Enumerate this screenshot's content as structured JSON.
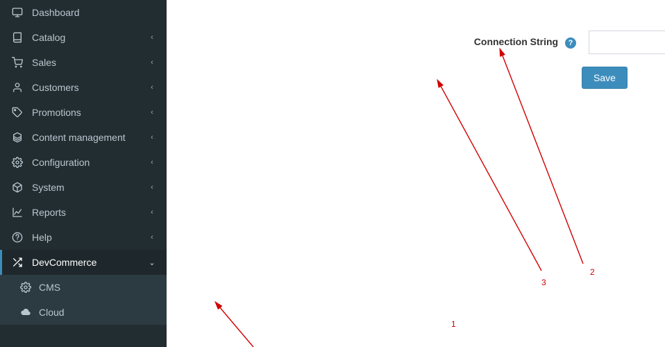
{
  "sidebar": {
    "items": [
      {
        "label": "Dashboard",
        "icon": "monitor",
        "expandable": false,
        "active": false
      },
      {
        "label": "Catalog",
        "icon": "book",
        "expandable": true,
        "active": false
      },
      {
        "label": "Sales",
        "icon": "cart",
        "expandable": true,
        "active": false
      },
      {
        "label": "Customers",
        "icon": "user",
        "expandable": true,
        "active": false
      },
      {
        "label": "Promotions",
        "icon": "tags",
        "expandable": true,
        "active": false
      },
      {
        "label": "Content management",
        "icon": "cubes",
        "expandable": true,
        "active": false
      },
      {
        "label": "Configuration",
        "icon": "gear",
        "expandable": true,
        "active": false
      },
      {
        "label": "System",
        "icon": "box",
        "expandable": true,
        "active": false
      },
      {
        "label": "Reports",
        "icon": "chart",
        "expandable": true,
        "active": false
      },
      {
        "label": "Help",
        "icon": "help",
        "expandable": true,
        "active": false
      },
      {
        "label": "DevCommerce",
        "icon": "shuffle",
        "expandable": true,
        "active": true,
        "children": [
          {
            "label": "CMS",
            "icon": "gear"
          },
          {
            "label": "Cloud",
            "icon": "cloud"
          }
        ]
      }
    ]
  },
  "form": {
    "connection_string_label": "Connection String",
    "connection_string_value": "",
    "save_label": "Save"
  },
  "annotations": {
    "n1": "1",
    "n2": "2",
    "n3": "3"
  },
  "icon_glyphs": {
    "monitor": "svg:monitor",
    "book": "svg:book",
    "cart": "svg:cart",
    "user": "svg:user",
    "tags": "svg:tags",
    "cubes": "svg:cubes",
    "gear": "svg:gear",
    "box": "svg:box",
    "chart": "svg:chart",
    "help": "svg:help",
    "shuffle": "svg:shuffle",
    "cloud": "svg:cloud"
  },
  "caret": {
    "left": "‹",
    "down": "⌄"
  }
}
